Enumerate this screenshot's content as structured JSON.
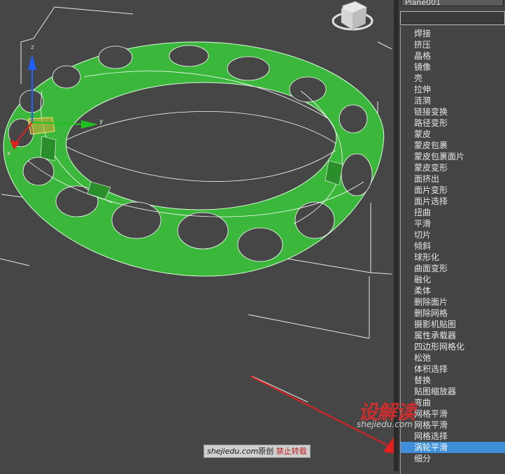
{
  "viewport": {
    "axis_labels": {
      "x": "x",
      "y": "y",
      "z": "z"
    },
    "colors": {
      "mesh": "#3bb83b",
      "mesh_dark": "#2a8f2a",
      "wire": "#ffffff",
      "background": "#464646",
      "arrow": "#e02020"
    }
  },
  "panel": {
    "object_name": "Plane001",
    "search_value": "",
    "modifiers": [
      "焊接",
      "挤压",
      "晶格",
      "镜像",
      "壳",
      "拉伸",
      "涟漪",
      "链接变换",
      "路径变形",
      "蒙皮",
      "蒙皮包裹",
      "蒙皮包裹面片",
      "蒙皮变形",
      "面挤出",
      "面片变形",
      "面片选择",
      "扭曲",
      "平滑",
      "切片",
      "倾斜",
      "球形化",
      "曲面变形",
      "融化",
      "柔体",
      "删除面片",
      "删除网格",
      "摄影机贴图",
      "属性承载器",
      "四边形网格化",
      "松弛",
      "体积选择",
      "替换",
      "贴图缩放器",
      "弯曲",
      "网格平滑",
      "网格平滑",
      "网格选择",
      "涡轮平滑",
      "细分"
    ],
    "selected_modifier": "涡轮平滑"
  },
  "watermark": {
    "logo": "设解读",
    "url": "shejiedu.com",
    "bar_site": "shejiedu.com",
    "bar_original": "原创",
    "bar_warning": "禁止转载"
  }
}
